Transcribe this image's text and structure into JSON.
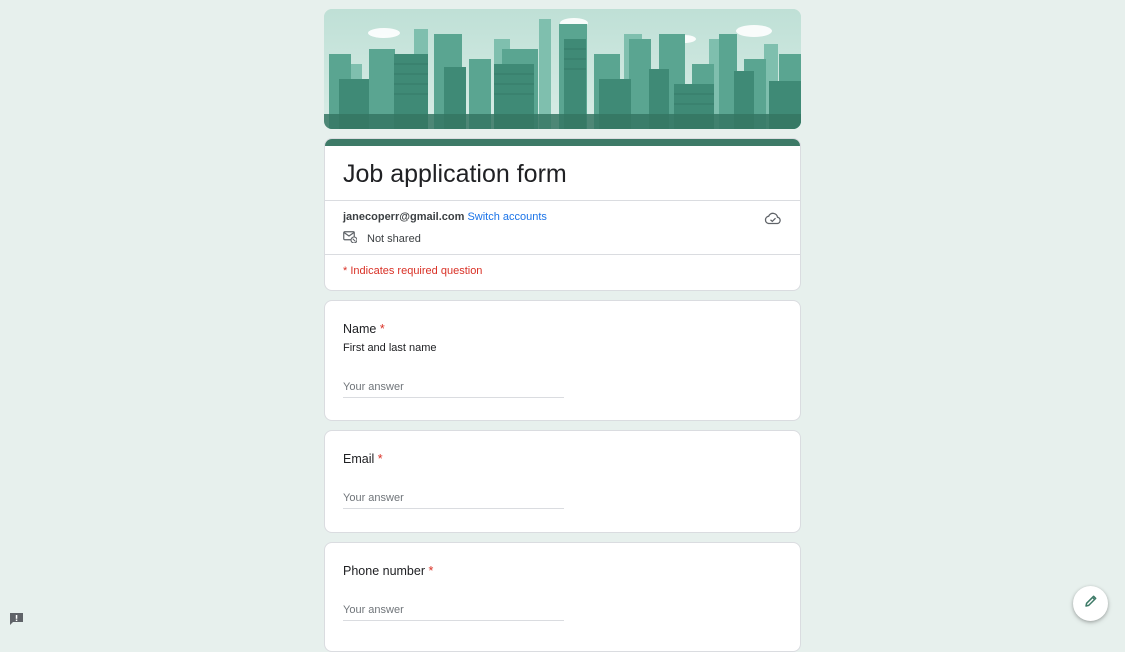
{
  "form": {
    "title": "Job application form",
    "account_email": "janecoperr@gmail.com",
    "switch_accounts": "Switch accounts",
    "not_shared": "Not shared",
    "required_note": "* Indicates required question"
  },
  "questions": [
    {
      "label": "Name",
      "required_mark": "*",
      "description": "First and last name",
      "placeholder": "Your answer",
      "value": ""
    },
    {
      "label": "Email",
      "required_mark": "*",
      "placeholder": "Your answer",
      "value": ""
    },
    {
      "label": "Phone number",
      "required_mark": "*",
      "placeholder": "Your answer",
      "value": ""
    }
  ],
  "icons": {
    "cloud": "cloud-done-icon",
    "mail": "mail-not-shared-icon",
    "feedback": "report-feedback-icon",
    "edit": "pencil-edit-icon"
  },
  "colors": {
    "accent": "#3d7a67",
    "background": "#e7f0ed",
    "required": "#d93025",
    "link": "#1a73e8"
  }
}
